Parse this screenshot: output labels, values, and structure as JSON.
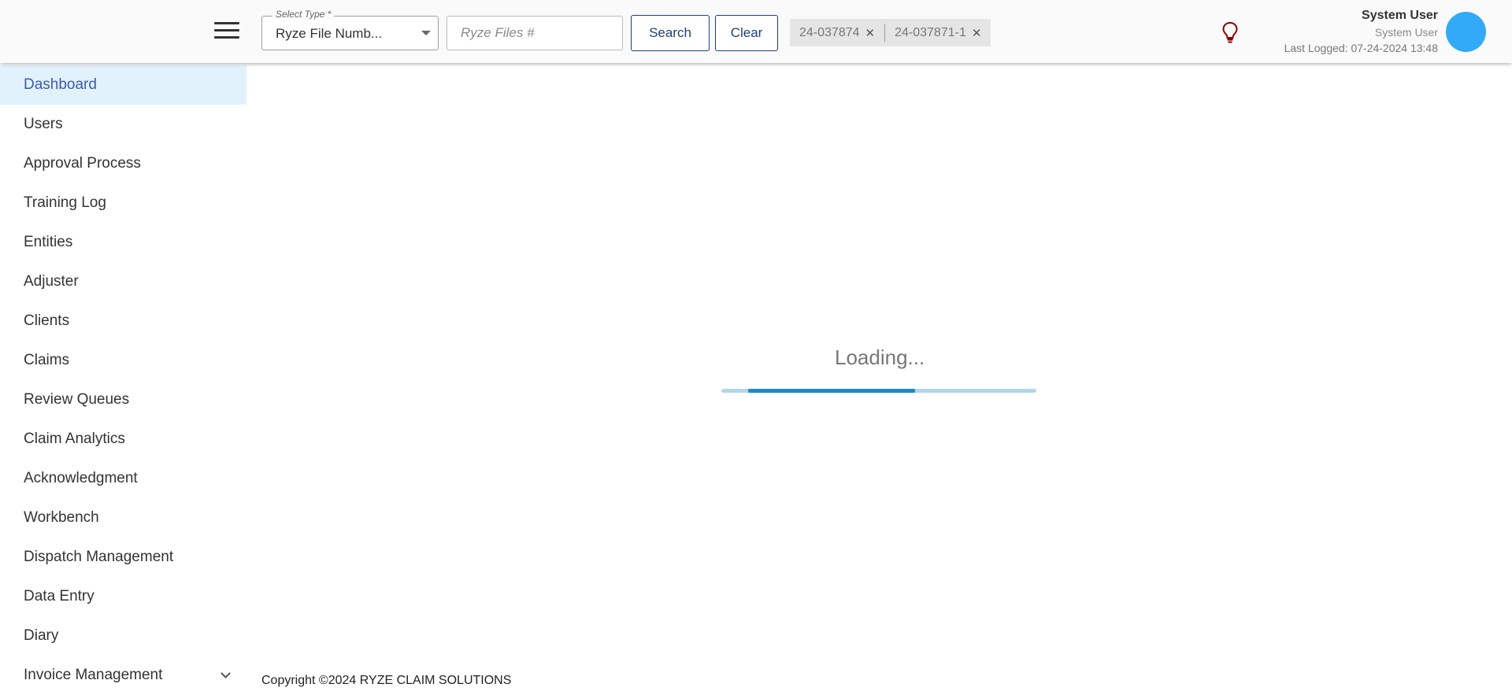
{
  "header": {
    "select_type": {
      "legend": "Select Type *",
      "value": "Ryze File Numb..."
    },
    "file_input": {
      "placeholder": "Ryze Files #",
      "value": ""
    },
    "search_label": "Search",
    "clear_label": "Clear",
    "chips": [
      {
        "label": "24-037874"
      },
      {
        "label": "24-037871-1"
      }
    ],
    "user": {
      "name": "System User",
      "role": "System User",
      "last_logged": "Last Logged: 07-24-2024 13:48"
    }
  },
  "sidebar": {
    "items": [
      {
        "label": "Dashboard",
        "active": true
      },
      {
        "label": "Users"
      },
      {
        "label": "Approval Process"
      },
      {
        "label": "Training Log"
      },
      {
        "label": "Entities"
      },
      {
        "label": "Adjuster"
      },
      {
        "label": "Clients"
      },
      {
        "label": "Claims"
      },
      {
        "label": "Review Queues"
      },
      {
        "label": "Claim Analytics"
      },
      {
        "label": "Acknowledgment"
      },
      {
        "label": "Workbench"
      },
      {
        "label": "Dispatch Management"
      },
      {
        "label": "Data Entry"
      },
      {
        "label": "Diary"
      },
      {
        "label": "Invoice Management",
        "expandable": true
      }
    ]
  },
  "main": {
    "loading_text": "Loading...",
    "progress": {
      "start": 0.085,
      "end": 0.615
    }
  },
  "footer": {
    "copyright": "Copyright ©2024 RYZE CLAIM SOLUTIONS"
  },
  "colors": {
    "accent": "#1c3f7a",
    "active_nav_bg": "#e2f2fd",
    "active_nav_text": "#3b5bab",
    "avatar": "#33aaf7",
    "progress_fill": "#168bd1",
    "progress_track": "#aed8ea",
    "bulb": "#8b0000"
  }
}
